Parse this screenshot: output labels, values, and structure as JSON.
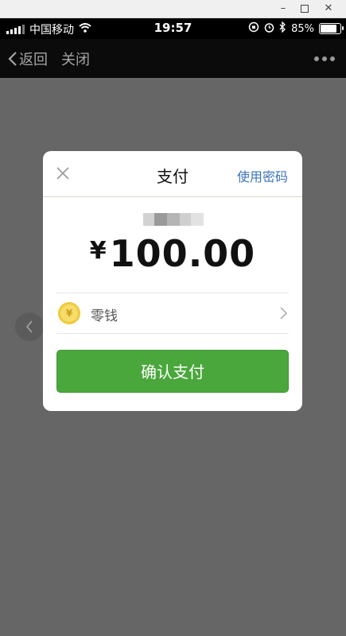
{
  "window": {
    "minimize_icon": "minimize-icon",
    "maximize_icon": "maximize-icon",
    "close_icon": "window-close-icon"
  },
  "status_bar": {
    "carrier": "中国移动",
    "time": "19:57",
    "battery_percent": "85%",
    "battery_level": 0.85
  },
  "nav": {
    "back_label": "返回",
    "close_label": "关闭"
  },
  "dialog": {
    "title": "支付",
    "password_link": "使用密码",
    "amount_currency": "¥",
    "amount_value": "100.00",
    "payment_method": "零钱",
    "coin_symbol": "¥",
    "confirm_label": "确认支付"
  },
  "colors": {
    "confirm_green": "#4aa73c",
    "link_blue": "#3b73b9",
    "overlay_gray": "#666666"
  }
}
